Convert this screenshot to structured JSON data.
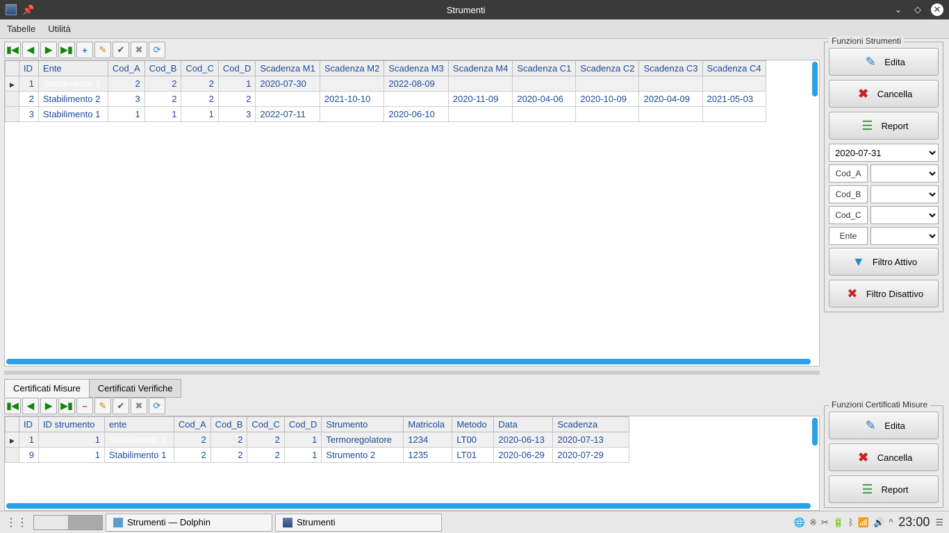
{
  "window": {
    "title": "Strumenti"
  },
  "menu": {
    "tabelle": "Tabelle",
    "utilita": "Utilità"
  },
  "main_grid": {
    "headers": [
      "ID",
      "Ente",
      "Cod_A",
      "Cod_B",
      "Cod_C",
      "Cod_D",
      "Scadenza M1",
      "Scadenza M2",
      "Scadenza M3",
      "Scadenza M4",
      "Scadenza C1",
      "Scadenza C2",
      "Scadenza C3",
      "Scadenza C4"
    ],
    "rows": [
      {
        "id": "1",
        "ente": "Stabilimento 1",
        "a": "2",
        "b": "2",
        "c": "2",
        "d": "1",
        "m1": "2020-07-30",
        "m2": "",
        "m3": "2022-08-09",
        "m4": "",
        "c1": "",
        "c2": "",
        "c3": "",
        "c4": ""
      },
      {
        "id": "2",
        "ente": "Stabilimento 2",
        "a": "3",
        "b": "2",
        "c": "2",
        "d": "2",
        "m1": "",
        "m2": "2021-10-10",
        "m3": "",
        "m4": "2020-11-09",
        "c1": "2020-04-06",
        "c2": "2020-10-09",
        "c3": "2020-04-09",
        "c4": "2021-05-03"
      },
      {
        "id": "3",
        "ente": "Stabilimento 1",
        "a": "1",
        "b": "1",
        "c": "1",
        "d": "3",
        "m1": "2022-07-11",
        "m2": "",
        "m3": "2020-06-10",
        "m4": "",
        "c1": "",
        "c2": "",
        "c3": "",
        "c4": ""
      }
    ]
  },
  "tabs": {
    "misure": "Certificati Misure",
    "verifiche": "Certificati Verifiche"
  },
  "cert_grid": {
    "headers": [
      "ID",
      "ID strumento",
      "ente",
      "Cod_A",
      "Cod_B",
      "Cod_C",
      "Cod_D",
      "Strumento",
      "Matricola",
      "Metodo",
      "Data",
      "Scadenza"
    ],
    "rows": [
      {
        "id": "1",
        "idstr": "1",
        "ente": "Stabilimento 1",
        "a": "2",
        "b": "2",
        "c": "2",
        "d": "1",
        "str": "Termoregolatore",
        "mat": "1234",
        "met": "LT00",
        "data": "2020-06-13",
        "scad": "2020-07-13"
      },
      {
        "id": "9",
        "idstr": "1",
        "ente": "Stabilimento 1",
        "a": "2",
        "b": "2",
        "c": "2",
        "d": "1",
        "str": "Strumento 2",
        "mat": "1235",
        "met": "LT01",
        "data": "2020-06-29",
        "scad": "2020-07-29"
      }
    ]
  },
  "funzioni_strumenti": {
    "title": "Funzioni Strumenti",
    "edita": "Edita",
    "cancella": "Cancella",
    "report": "Report",
    "date": "2020-07-31",
    "cod_a": "Cod_A",
    "cod_b": "Cod_B",
    "cod_c": "Cod_C",
    "ente": "Ente",
    "filtro_attivo": "Filtro Attivo",
    "filtro_disattivo": "Filtro Disattivo"
  },
  "funzioni_cert": {
    "title": "Funzioni Certificati Misure",
    "edita": "Edita",
    "cancella": "Cancella",
    "report": "Report"
  },
  "taskbar": {
    "dolphin": "Strumenti — Dolphin",
    "app": "Strumenti",
    "clock": "23:00"
  }
}
